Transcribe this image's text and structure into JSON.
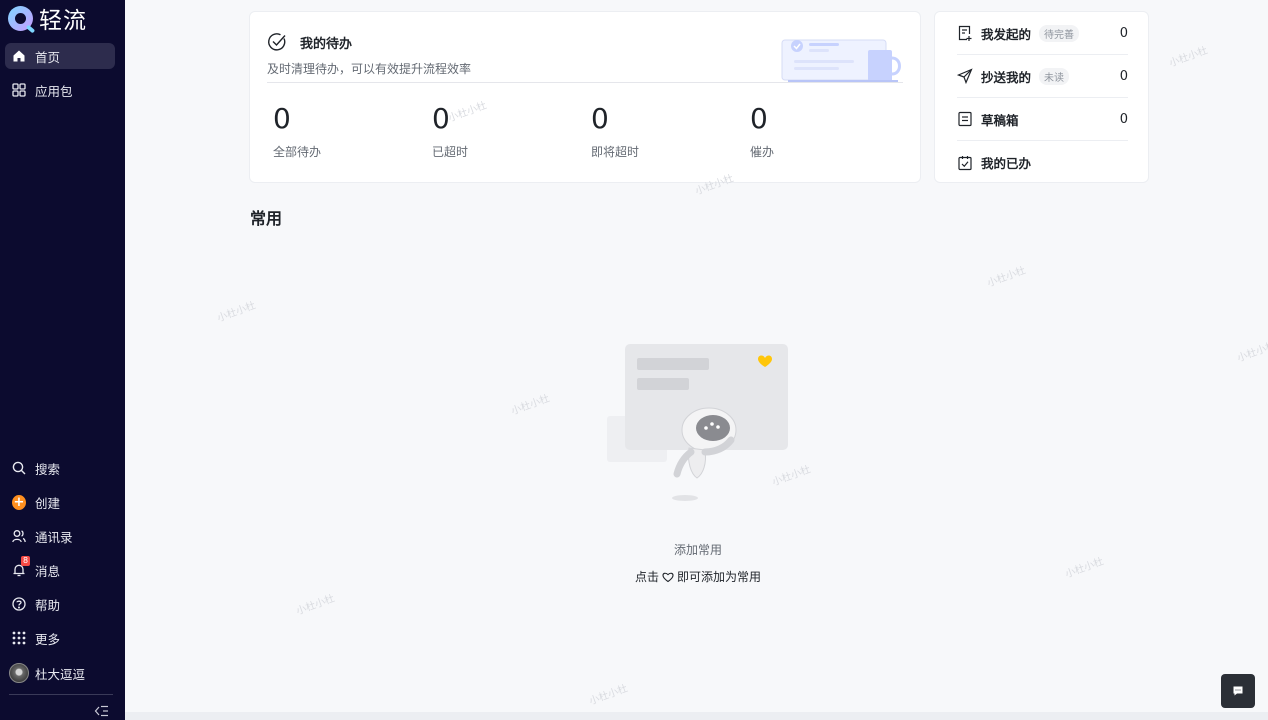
{
  "app": {
    "logo_text": "轻流"
  },
  "sidebar": {
    "top_items": [
      {
        "label": "首页",
        "icon": "home-icon",
        "active": true
      },
      {
        "label": "应用包",
        "icon": "apps-grid-icon",
        "active": false
      }
    ],
    "bottom_items": [
      {
        "label": "搜索",
        "icon": "search-icon"
      },
      {
        "label": "创建",
        "icon": "create-plus-icon"
      },
      {
        "label": "通讯录",
        "icon": "contacts-icon"
      },
      {
        "label": "消息",
        "icon": "bell-icon",
        "badge": "8"
      },
      {
        "label": "帮助",
        "icon": "help-icon"
      },
      {
        "label": "更多",
        "icon": "more-grid-icon"
      }
    ],
    "user": {
      "name": "杜大逗逗",
      "icon": "avatar"
    }
  },
  "todo": {
    "title": "我的待办",
    "subtitle": "及时清理待办，可以有效提升流程效率",
    "stats": [
      {
        "value": "0",
        "label": "全部待办"
      },
      {
        "value": "0",
        "label": "已超时"
      },
      {
        "value": "0",
        "label": "即将超时"
      },
      {
        "value": "0",
        "label": "催办"
      }
    ]
  },
  "side_panel": {
    "rows": [
      {
        "label": "我发起的",
        "tag": "待完善",
        "count": "0",
        "icon": "doc-plus-icon"
      },
      {
        "label": "抄送我的",
        "tag": "未读",
        "count": "0",
        "icon": "send-icon"
      },
      {
        "label": "草稿箱",
        "tag": "",
        "count": "0",
        "icon": "draft-icon"
      },
      {
        "label": "我的已办",
        "tag": "",
        "count": "",
        "icon": "done-check-icon"
      }
    ]
  },
  "common": {
    "title": "常用",
    "empty_title": "添加常用",
    "hint_prefix": "点击",
    "hint_suffix": "即可添加为常用"
  },
  "watermark": {
    "text": "小杜小杜"
  },
  "colors": {
    "sidebar_bg": "#0c0b2f",
    "accent_orange": "#ff8f1f",
    "badge_red": "#f54a45",
    "heart_yellow": "#ffc60a"
  }
}
